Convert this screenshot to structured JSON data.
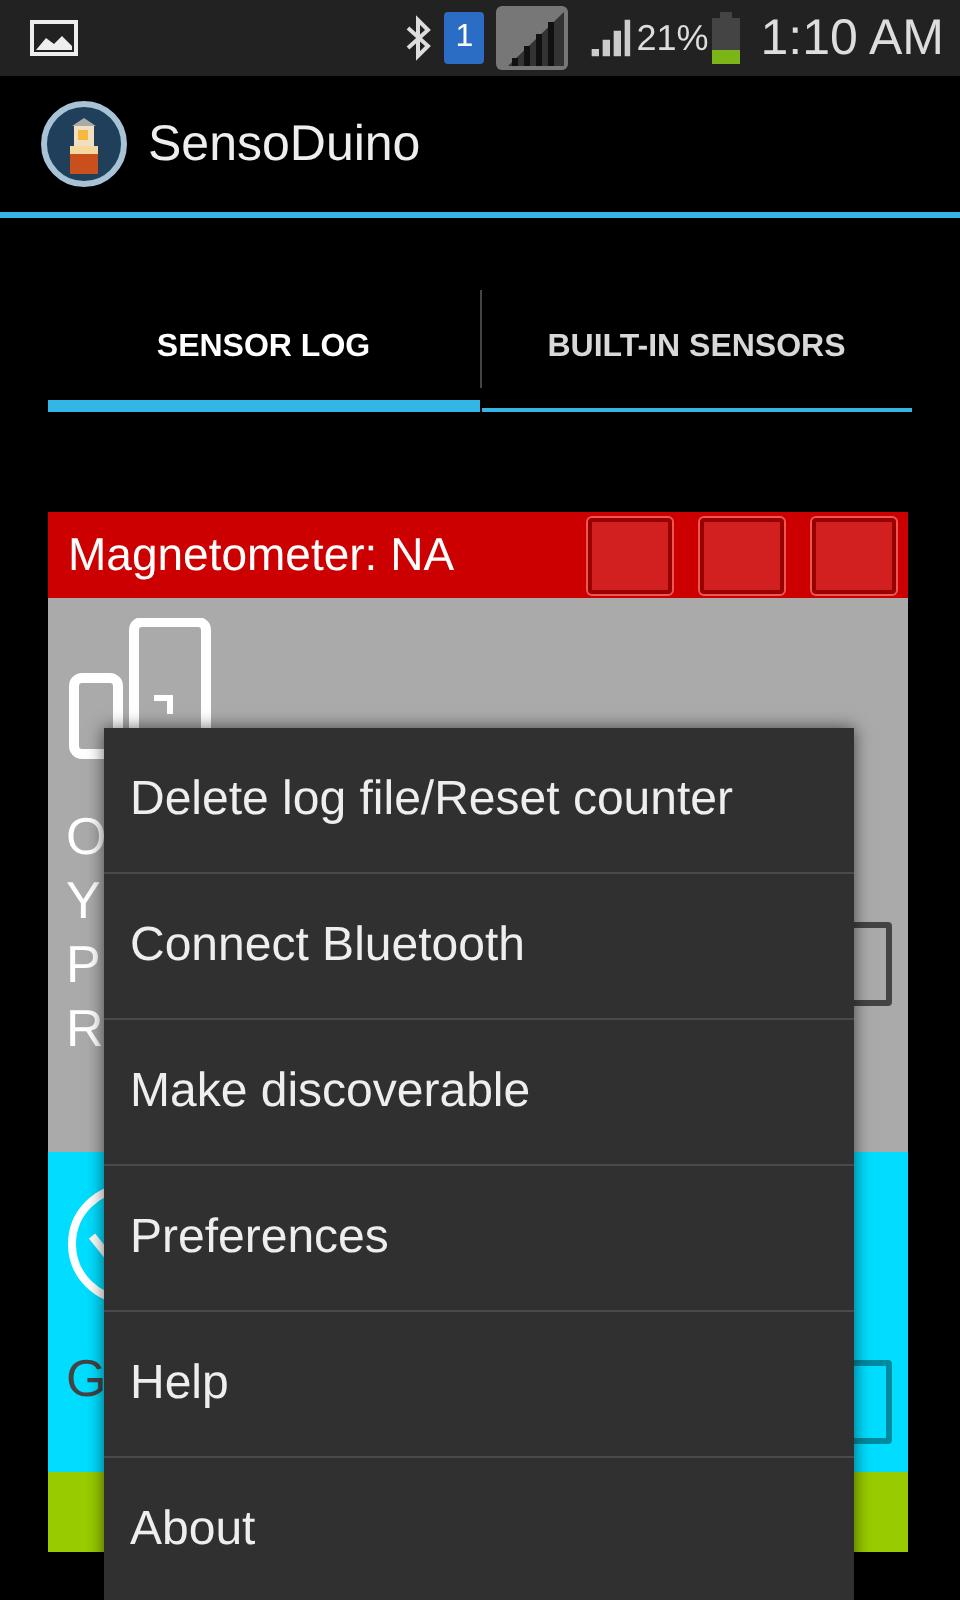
{
  "status_bar": {
    "sim_badge": "1",
    "battery": "21%",
    "time": "1:10 AM"
  },
  "action_bar": {
    "title": "SensoDuino"
  },
  "tabs": [
    {
      "label": "SENSOR LOG",
      "selected": true
    },
    {
      "label": "BUILT-IN SENSORS",
      "selected": false
    }
  ],
  "panels": [
    {
      "kind": "magnetometer",
      "color": "#cc0000",
      "label": "Magnetometer: NA"
    },
    {
      "kind": "orientation",
      "color": "#aaaaaa",
      "lines": [
        "O",
        "Y",
        "P",
        "R"
      ]
    },
    {
      "kind": "gyroscope",
      "color": "#00ddff",
      "lines": [
        "G"
      ]
    },
    {
      "kind": "plain",
      "color": "#99cc00"
    }
  ],
  "menu": {
    "items": [
      "Delete log file/Reset counter",
      "Connect Bluetooth",
      "Make discoverable",
      "Preferences",
      "Help",
      "About"
    ]
  }
}
